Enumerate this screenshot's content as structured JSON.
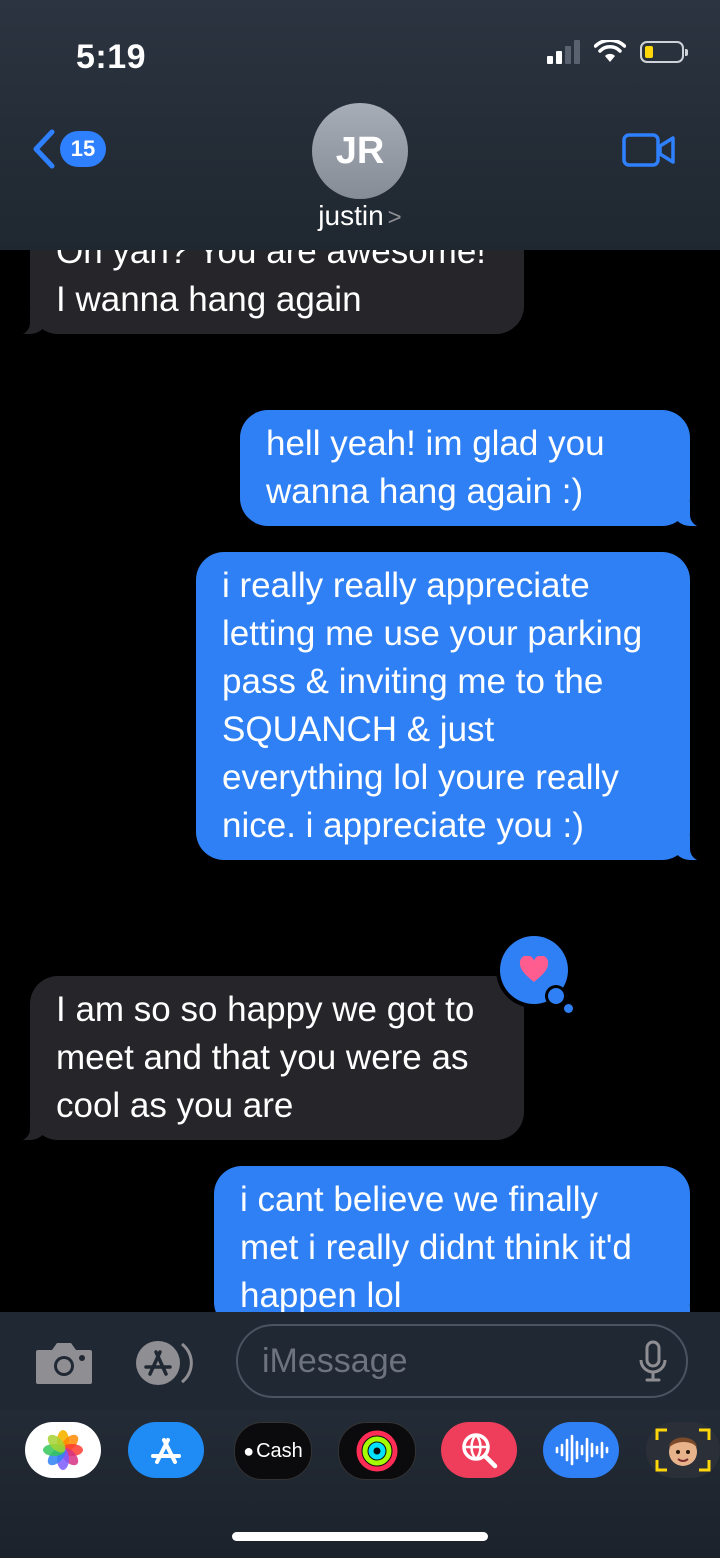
{
  "status_bar": {
    "time": "5:19"
  },
  "header": {
    "back_badge": "15",
    "avatar_initials": "JR",
    "contact_name": "justin",
    "contact_chevron": ">"
  },
  "messages": [
    {
      "direction": "incoming",
      "text": "Oh yah? You are awesome! I wanna hang again"
    },
    {
      "direction": "outgoing",
      "text": "hell yeah! im glad you wanna hang again :)"
    },
    {
      "direction": "outgoing",
      "text": "i really really appreciate letting me use your parking pass & inviting me to the SQUANCH & just everything lol youre really nice. i appreciate you :)"
    },
    {
      "direction": "incoming",
      "text": "I am so so happy we got to meet and that you were as cool as you are",
      "reaction": "heart"
    },
    {
      "direction": "outgoing",
      "text": "i cant believe we finally met i really didnt think it'd happen lol"
    }
  ],
  "input_bar": {
    "placeholder": "iMessage"
  },
  "app_drawer": {
    "apps": [
      {
        "icon": "photos-icon"
      },
      {
        "icon": "app-store-icon"
      },
      {
        "icon": "apple-cash-icon",
        "label": "Cash"
      },
      {
        "icon": "activity-icon"
      },
      {
        "icon": "search-images-icon"
      },
      {
        "icon": "audio-message-icon"
      },
      {
        "icon": "memoji-icon"
      }
    ]
  },
  "colors": {
    "outgoing_bubble": "#2f80f5",
    "incoming_bubble": "#26262a",
    "accent": "#2e80ff",
    "reaction_heart": "#ff5d8f"
  }
}
